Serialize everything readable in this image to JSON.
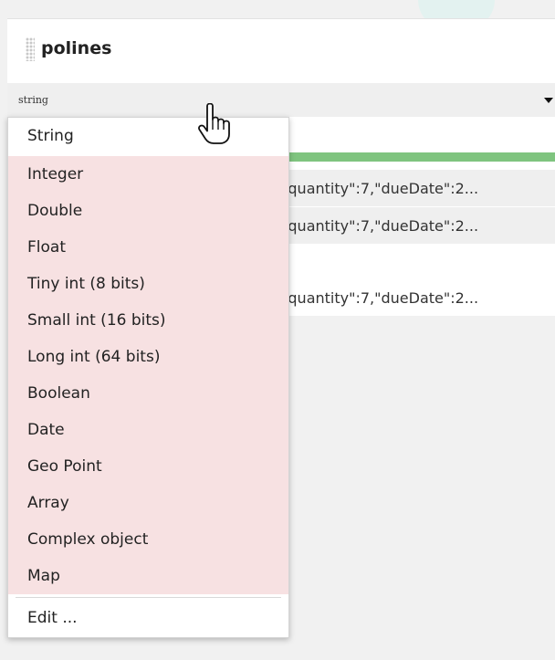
{
  "column": {
    "name": "polines",
    "type_value": "string"
  },
  "cells": [
    "'quantity\":7,\"dueDate\":2...",
    "'quantity\":7,\"dueDate\":2...",
    "'quantity\":7,\"dueDate\":2..."
  ],
  "menu": {
    "items": [
      "String",
      "Integer",
      "Double",
      "Float",
      "Tiny int (8 bits)",
      "Small int (16 bits)",
      "Long int (64 bits)",
      "Boolean",
      "Date",
      "Geo Point",
      "Array",
      "Complex object",
      "Map"
    ],
    "edit_label": "Edit ..."
  },
  "colors": {
    "menu_option_bg": "#f7e1e2",
    "selected_bg": "#ffffff",
    "accent_bar": "#7fc47f",
    "type_select_bg": "#efefef"
  },
  "icons": {
    "cursor": "hand-pointer-icon",
    "caret": "caret-down-icon",
    "drag_handle": "drag-handle-icon"
  }
}
